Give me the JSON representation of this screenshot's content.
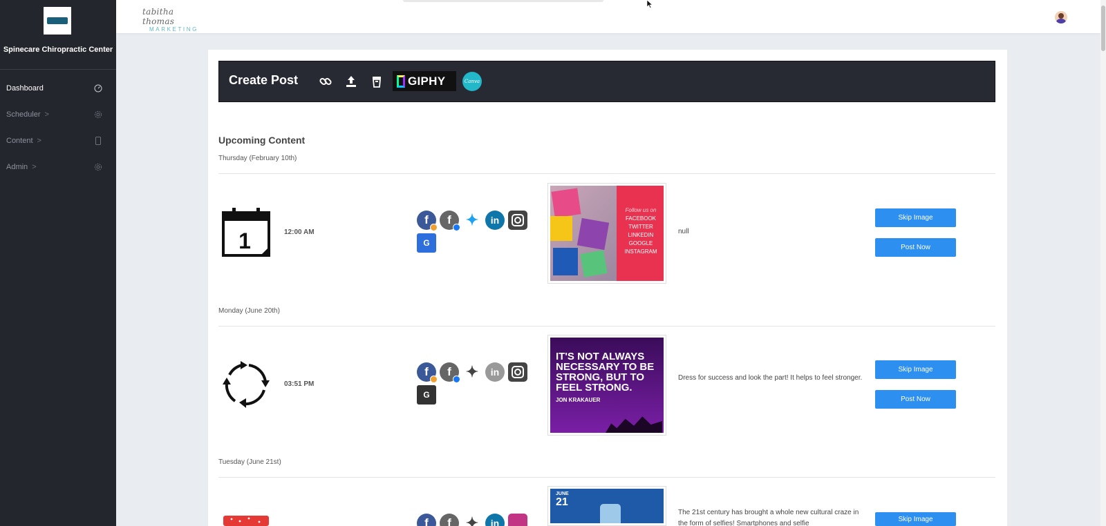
{
  "sidebar": {
    "org_name": "Spinecare Chiropractic Center",
    "items": [
      {
        "label": "Dashboard",
        "icon": "dashboard-gauge-icon",
        "active": true
      },
      {
        "label": "Scheduler",
        "icon": "gear-icon",
        "chevron": ">"
      },
      {
        "label": "Content",
        "icon": "tablet-icon",
        "chevron": ">"
      },
      {
        "label": "Admin",
        "icon": "gear-icon",
        "chevron": ">"
      }
    ]
  },
  "topbar": {
    "brand_top": "tabitha thomas",
    "brand_bottom": "MARKETING"
  },
  "create_post": {
    "title": "Create Post",
    "icons": [
      "link-icon",
      "upload-icon",
      "trash-icon"
    ],
    "giphy_label": "GIPHY",
    "canva_label": "Canva"
  },
  "upcoming": {
    "title": "Upcoming Content",
    "posts": [
      {
        "day": "Thursday (February 10th)",
        "time": "12:00 AM",
        "icon": "calendar-one-icon",
        "caption": "null",
        "image_text": [
          "Follow us on",
          "FACEBOOK",
          "TWITTER",
          "LINKEDIN",
          "GOOGLE",
          "INSTAGRAM"
        ],
        "skip_label": "Skip Image",
        "post_label": "Post Now"
      },
      {
        "day": "Monday (June 20th)",
        "time": "03:51 PM",
        "icon": "recurring-arrows-icon",
        "caption": "Dress for success and look the part! It helps to feel stronger.",
        "image_text": [
          "IT'S NOT ALWAYS NECESSARY TO BE STRONG, BUT TO FEEL STRONG.",
          "JON KRAKAUER"
        ],
        "skip_label": "Skip Image",
        "post_label": "Post Now"
      },
      {
        "day": "Tuesday (June 21st)",
        "icon": "calendar-red-icon",
        "caption": "The 21st century has brought a whole new cultural craze in the form of selfies! Smartphones and selfie",
        "image_text": [
          "JUNE",
          "21"
        ],
        "skip_label": "Skip Image"
      }
    ]
  },
  "colors": {
    "sidebar_bg": "#24262e",
    "primary_button": "#2d8ff0",
    "facebook": "#3b5998",
    "twitter": "#1da1f2",
    "linkedin": "#0e76a8",
    "instagram": "#444444"
  }
}
